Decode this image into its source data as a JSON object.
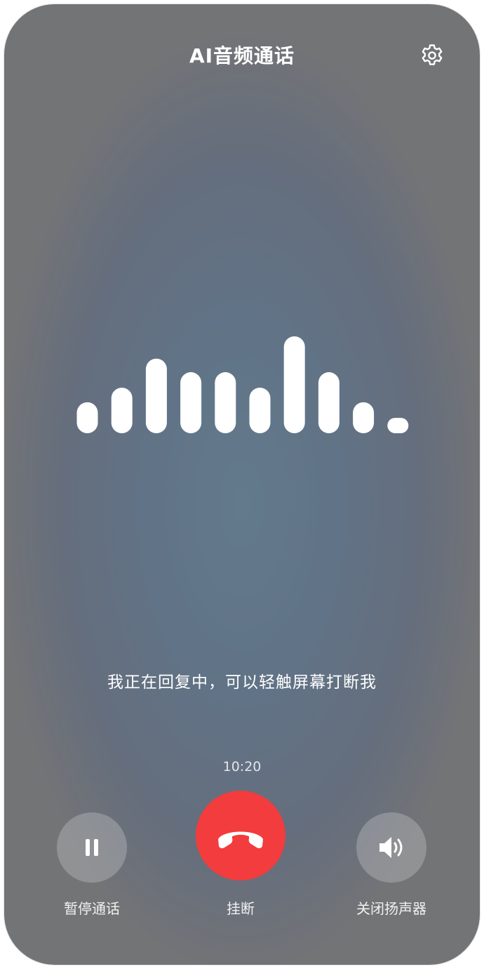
{
  "header": {
    "title": "AI音频通话",
    "settings_icon": "gear-icon"
  },
  "waveform": {
    "bar_levels": [
      0.32,
      0.47,
      0.77,
      0.63,
      0.63,
      0.47,
      1.0,
      0.63,
      0.32,
      0.1
    ],
    "color": "#ffffff"
  },
  "status": {
    "text": "我正在回复中，可以轻触屏幕打断我"
  },
  "call": {
    "timer": "10:20"
  },
  "controls": {
    "pause": {
      "label": "暂停通话",
      "icon": "pause-icon"
    },
    "hangup": {
      "label": "挂断",
      "icon": "phone-hangup-icon",
      "color": "#f23c3d"
    },
    "speaker": {
      "label": "关闭扬声器",
      "icon": "speaker-icon"
    }
  }
}
